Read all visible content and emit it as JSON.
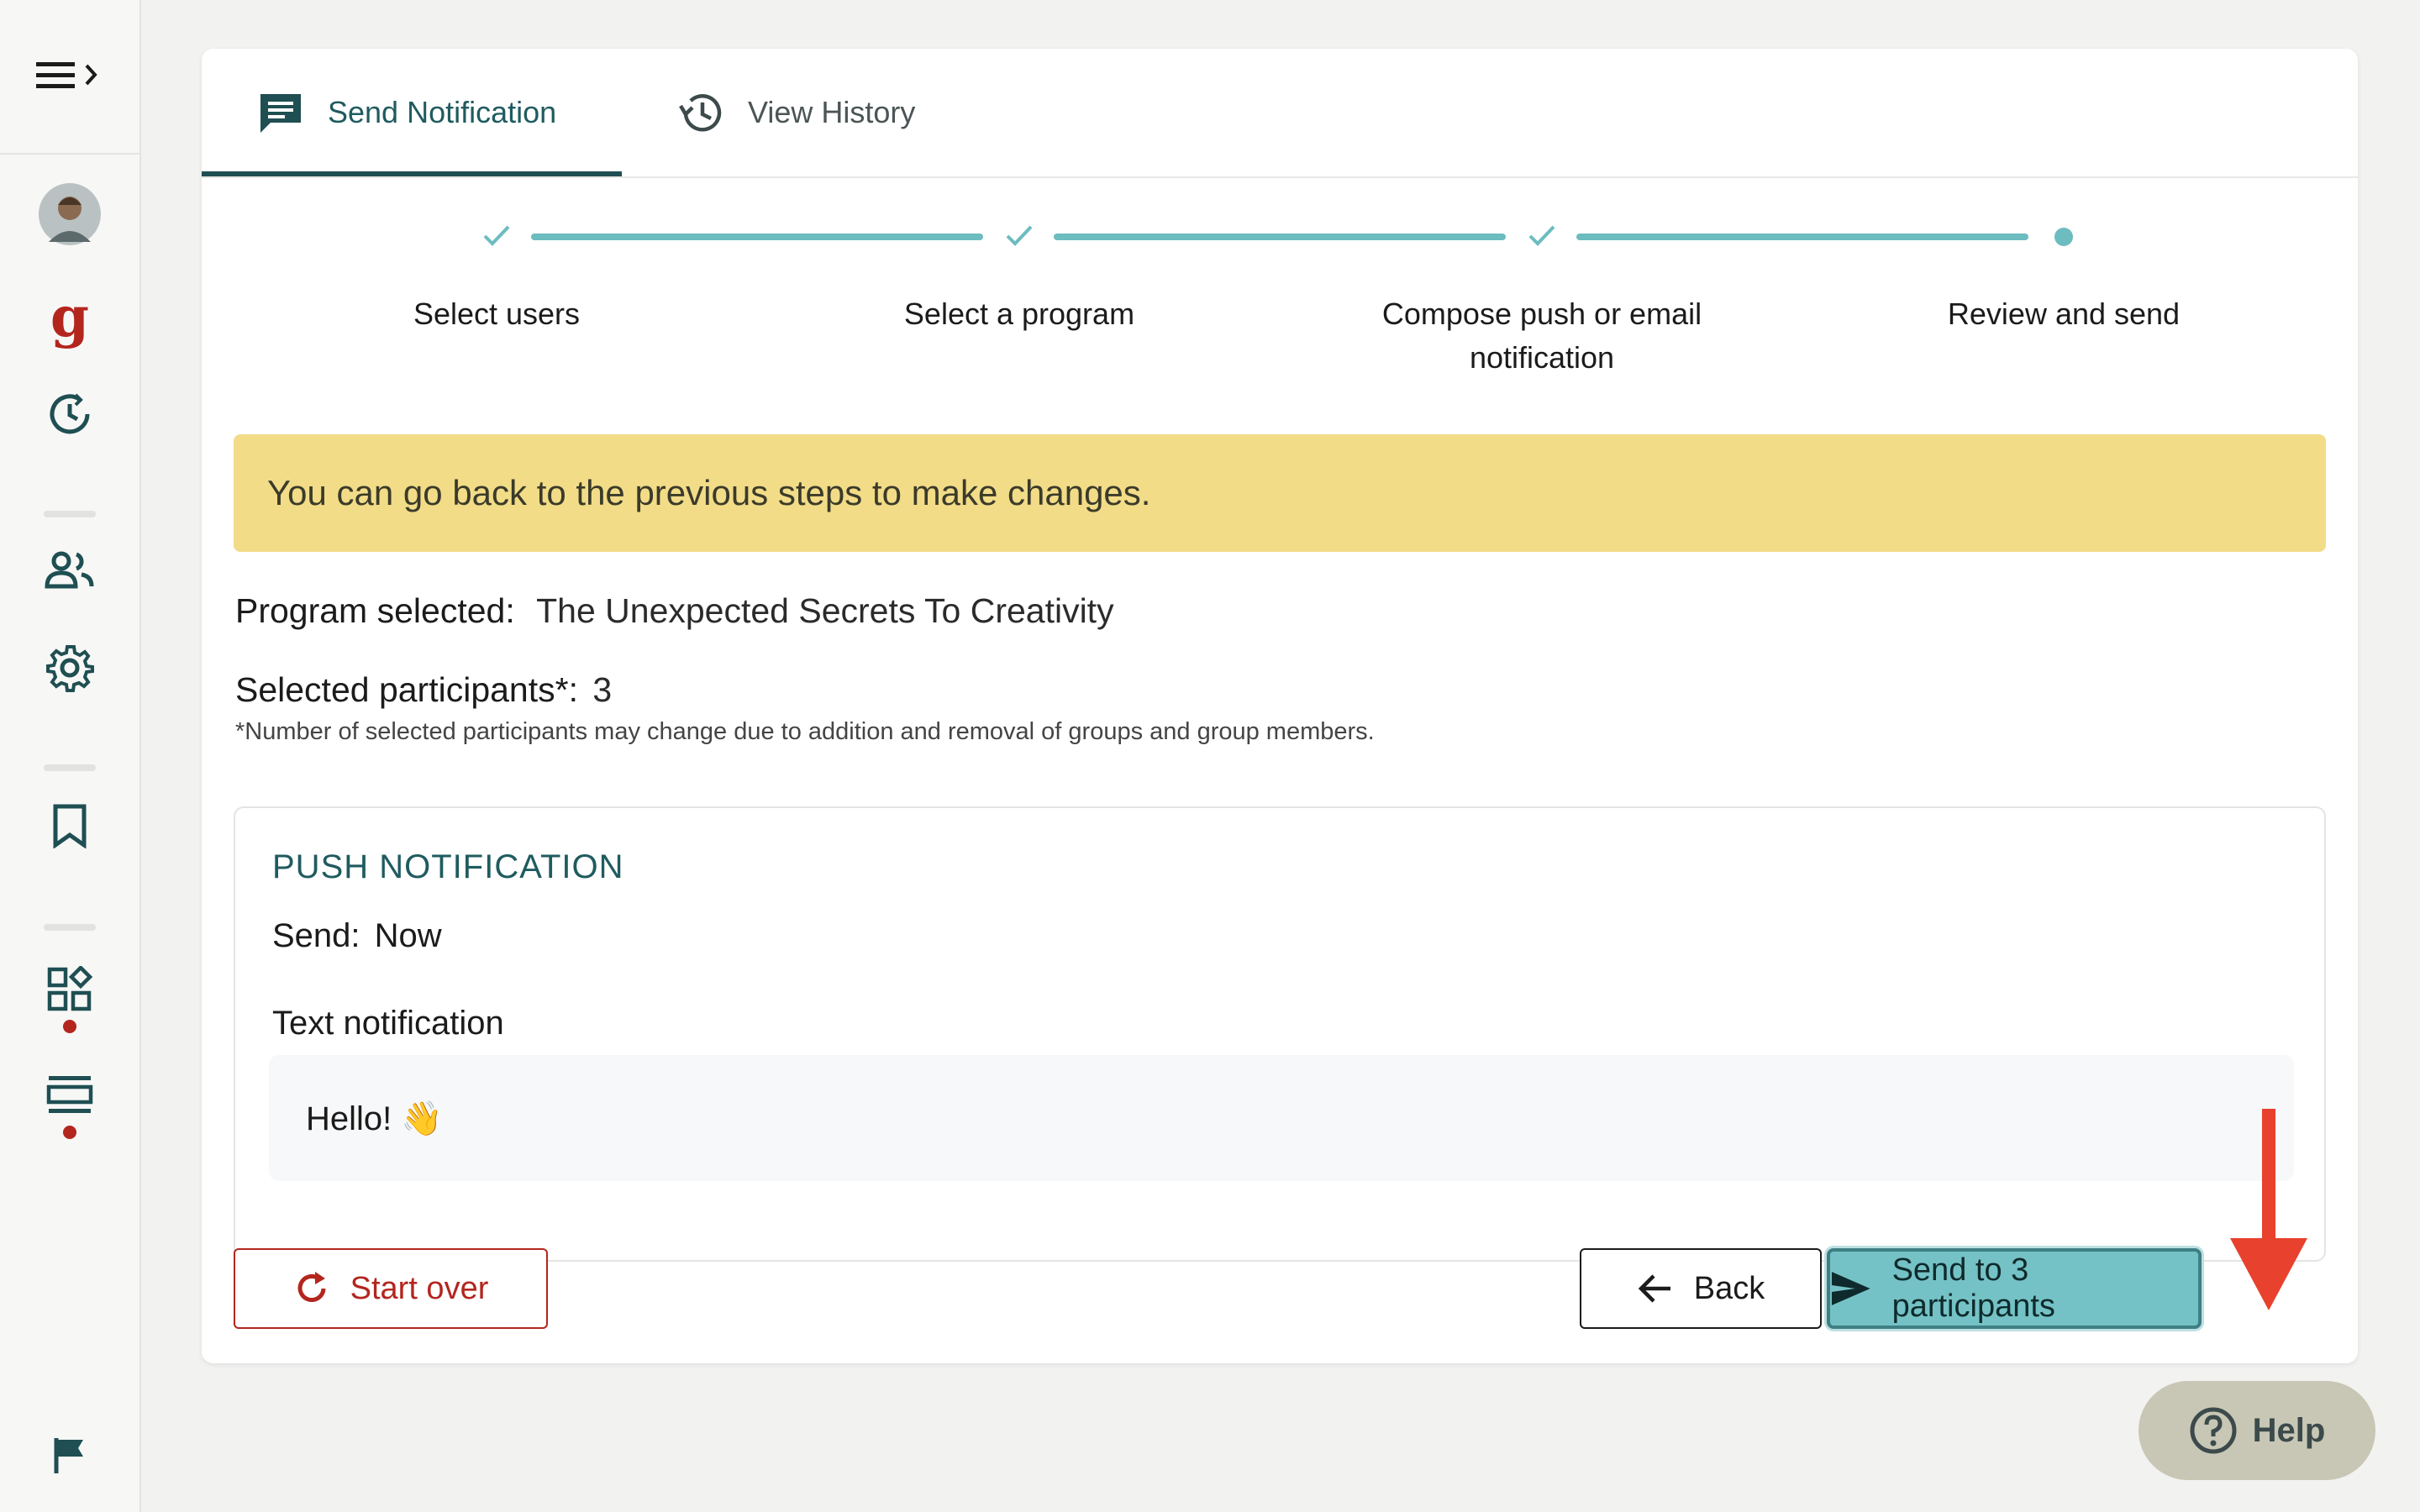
{
  "sidebar": {
    "menu_icon": "menu-expand-icon",
    "items": [
      {
        "name": "avatar",
        "icon": "avatar"
      },
      {
        "name": "brand-g-icon",
        "label": "g"
      },
      {
        "name": "history-clock-icon"
      },
      {
        "name": "users-icon"
      },
      {
        "name": "gear-icon"
      },
      {
        "name": "bookmark-icon"
      },
      {
        "name": "widgets-icon"
      },
      {
        "name": "list-view-icon"
      },
      {
        "name": "flag-icon"
      }
    ]
  },
  "tabs": [
    {
      "label": "Send Notification",
      "icon": "message-icon",
      "active": true
    },
    {
      "label": "View History",
      "icon": "history-icon",
      "active": false
    }
  ],
  "stepper": {
    "steps": [
      {
        "label": "Select users",
        "status": "complete"
      },
      {
        "label": "Select a program",
        "status": "complete"
      },
      {
        "label": "Compose push or email notification",
        "status": "complete"
      },
      {
        "label": "Review and send",
        "status": "current"
      }
    ]
  },
  "notice": "You can go back to the previous steps to make changes.",
  "program": {
    "label": "Program selected:",
    "value": "The Unexpected Secrets To Creativity"
  },
  "participants": {
    "label": "Selected participants*:",
    "value": "3",
    "note": "*Number of selected participants may change due to addition and removal of groups and group members."
  },
  "push": {
    "title": "PUSH NOTIFICATION",
    "send_label": "Send:",
    "send_value": "Now",
    "text_label": "Text notification",
    "message": "Hello! 👋"
  },
  "buttons": {
    "start_over": "Start over",
    "back": "Back",
    "send": "Send to 3 participants"
  },
  "help": "Help",
  "colors": {
    "accent": "#74c2c6",
    "teal_dark": "#1f4f52",
    "danger": "#b3261e",
    "notice_bg": "#f2dc88",
    "annotation": "#e8412d"
  }
}
